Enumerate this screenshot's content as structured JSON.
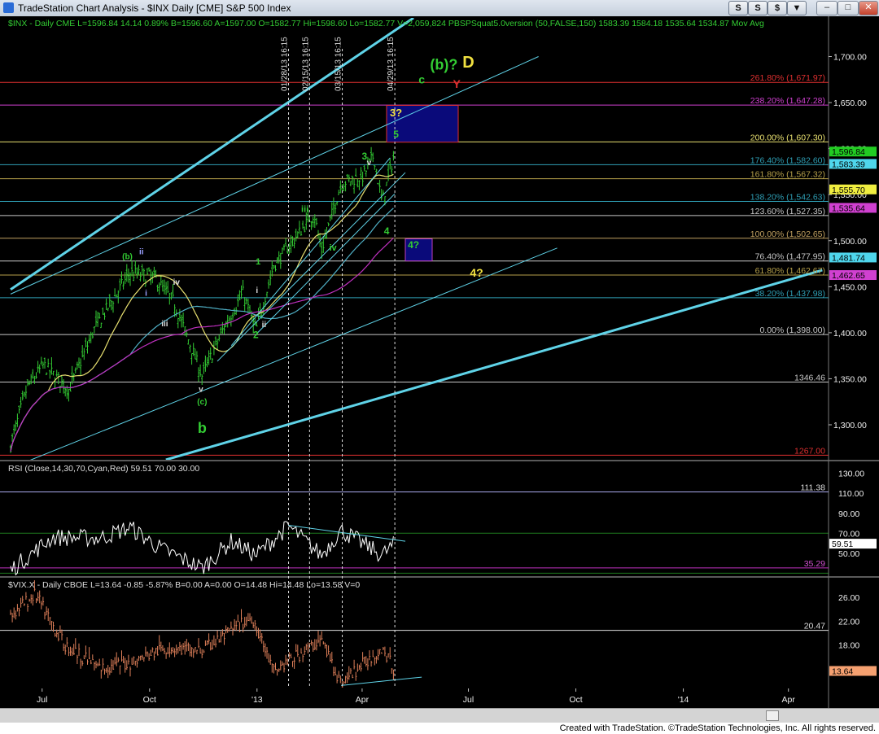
{
  "window": {
    "title": "TradeStation Chart Analysis - $INX Daily [CME] S&P 500 Index",
    "toolbar_buttons": [
      "S",
      "S",
      "$",
      "▼"
    ],
    "window_buttons": [
      "–",
      "□",
      "✕"
    ]
  },
  "footer": {
    "text": "Created with TradeStation. ©TradeStation Technologies, Inc. All rights reserved."
  },
  "colors": {
    "background": "#000000",
    "price_bar": "#33cc33",
    "vix_bar": "#e0805a",
    "rsi_line": "#ffffff",
    "channel": "#5fd3e8",
    "ma_yellow": "#e8e070",
    "ma_cyan": "#4fb0c6",
    "ma_magenta": "#c030c0"
  },
  "chart_data": [
    {
      "type": "candlestick",
      "header": "$INX - Daily CME L=1596.84 14.14 0.89% B=1596.60 A=1597.00 O=1582.77 Hi=1598.60 Lo=1582.77 V=2,059,824 PBSPSquat5.0version (50,FALSE,150) 1583.39 1584.18 1535.64 1534.87 Mov Avg",
      "x_ticks": [
        "Jul",
        "Oct",
        "'13",
        "Apr",
        "Jul",
        "Oct",
        "'14",
        "Apr"
      ],
      "y_ticks": [
        "1,700.00",
        "1,650.00",
        "1,600.00",
        "1,550.00",
        "1,500.00",
        "1,450.00",
        "1,400.00",
        "1,350.00",
        "1,300.00"
      ],
      "ylim": [
        1262,
        1742
      ],
      "grid": false,
      "series_close": [
        {
          "date": "2012-06-04",
          "value": 1278
        },
        {
          "date": "2012-06-18",
          "value": 1340
        },
        {
          "date": "2012-07-02",
          "value": 1365
        },
        {
          "date": "2012-07-24",
          "value": 1338
        },
        {
          "date": "2012-08-15",
          "value": 1405
        },
        {
          "date": "2012-09-14",
          "value": 1465
        },
        {
          "date": "2012-10-05",
          "value": 1460
        },
        {
          "date": "2012-10-22",
          "value": 1433
        },
        {
          "date": "2012-11-15",
          "value": 1353
        },
        {
          "date": "2012-12-05",
          "value": 1409
        },
        {
          "date": "2012-12-20",
          "value": 1443
        },
        {
          "date": "2012-12-31",
          "value": 1402
        },
        {
          "date": "2013-01-15",
          "value": 1472
        },
        {
          "date": "2013-02-19",
          "value": 1530
        },
        {
          "date": "2013-02-25",
          "value": 1488
        },
        {
          "date": "2013-03-14",
          "value": 1563
        },
        {
          "date": "2013-04-02",
          "value": 1570
        },
        {
          "date": "2013-04-11",
          "value": 1593
        },
        {
          "date": "2013-04-18",
          "value": 1541
        },
        {
          "date": "2013-04-29",
          "value": 1597
        }
      ],
      "levels": [
        {
          "label": "261.80% (1,671.97)",
          "value": 1671.97,
          "color": "#e03030"
        },
        {
          "label": "238.20% (1,647.28)",
          "value": 1647.28,
          "color": "#d040d0"
        },
        {
          "label": "200.00% (1,607.30)",
          "value": 1607.3,
          "color": "#e8e070"
        },
        {
          "label": "176.40% (1,582.60)",
          "value": 1582.6,
          "color": "#2f9fb5"
        },
        {
          "label": "161.80% (1,567.32)",
          "value": 1567.32,
          "color": "#b6a04a"
        },
        {
          "label": "138.20% (1,542.63)",
          "value": 1542.63,
          "color": "#2f9fb5"
        },
        {
          "label": "123.60% (1,527.35)",
          "value": 1527.35,
          "color": "#c7c7c7"
        },
        {
          "label": "100.00% (1,502.65)",
          "value": 1502.65,
          "color": "#c0a060"
        },
        {
          "label": "76.40% (1,477.95)",
          "value": 1477.95,
          "color": "#c7c7c7"
        },
        {
          "label": "61.80% (1,462.67)",
          "value": 1462.67,
          "color": "#b6a04a"
        },
        {
          "label": "38.20% (1,437.98)",
          "value": 1437.98,
          "color": "#2f9fb5"
        },
        {
          "label": "0.00% (1,398.00)",
          "value": 1398.0,
          "color": "#c7c7c7"
        },
        {
          "label": "1346.46",
          "value": 1346.46,
          "color": "#c7c7c7"
        },
        {
          "label": "1267.00",
          "value": 1267.0,
          "color": "#e03030"
        }
      ],
      "right_labels": [
        {
          "label": "1,596.84",
          "value": 1596.84,
          "bg": "#22cc22"
        },
        {
          "label": "1,583.39",
          "value": 1583.39,
          "bg": "#4fd6ec"
        },
        {
          "label": "1,555.70",
          "value": 1555.7,
          "bg": "#f0ee40"
        },
        {
          "label": "1,535.64",
          "value": 1535.64,
          "bg": "#d040d0"
        },
        {
          "label": "1,481.74",
          "value": 1481.74,
          "bg": "#4fd6ec"
        },
        {
          "label": "1,462.65",
          "value": 1462.65,
          "bg": "#d040d0"
        }
      ],
      "vertical_markers": [
        "01/28/13 16:15",
        "02/15/13 16:15",
        "03/15/13 16:15",
        "04/29/13 16:15"
      ],
      "annotations": [
        {
          "text": "(b)",
          "color": "#33cc33"
        },
        {
          "text": "ii",
          "color": "#9aa0ff"
        },
        {
          "text": "iv",
          "color": "#dddddd"
        },
        {
          "text": "i",
          "color": "#9aa0ff"
        },
        {
          "text": "iii",
          "color": "#dddddd"
        },
        {
          "text": "v",
          "color": "#dddddd"
        },
        {
          "text": "(c)",
          "color": "#33cc33"
        },
        {
          "text": "b",
          "color": "#33cc33"
        },
        {
          "text": "1",
          "color": "#33cc33"
        },
        {
          "text": "i",
          "color": "#dddddd"
        },
        {
          "text": "ii",
          "color": "#dddddd"
        },
        {
          "text": "2",
          "color": "#33cc33"
        },
        {
          "text": "iii",
          "color": "#33cc33"
        },
        {
          "text": "iv",
          "color": "#33cc33"
        },
        {
          "text": "3",
          "color": "#33cc33"
        },
        {
          "text": "v",
          "color": "#dddddd"
        },
        {
          "text": "4",
          "color": "#33cc33"
        },
        {
          "text": "5",
          "color": "#33cc33"
        },
        {
          "text": "3?",
          "color": "#f0e040"
        },
        {
          "text": "4?",
          "color": "#33cc33"
        },
        {
          "text": "4?",
          "color": "#f0e040"
        },
        {
          "text": "c",
          "color": "#33cc33"
        },
        {
          "text": "(b)?",
          "color": "#33cc33"
        },
        {
          "text": "D",
          "color": "#f0e040"
        },
        {
          "text": "Y",
          "color": "#e03030"
        }
      ]
    },
    {
      "type": "line",
      "header": "RSI (Close,14,30,70,Cyan,Red) 59.51 70.00 30.00",
      "y_ticks": [
        "130.00",
        "110.00",
        "90.00",
        "70.00",
        "50.00"
      ],
      "ylim": [
        27,
        142
      ],
      "levels": [
        {
          "label": "111.38",
          "value": 111.38
        },
        {
          "label": "35.29",
          "value": 35.29
        }
      ],
      "right_labels": [
        {
          "label": "59.51",
          "value": 59.51,
          "bg": "#ffffff"
        }
      ],
      "series_name": "RSI",
      "series_values": [
        {
          "date": "2012-06-04",
          "value": 33
        },
        {
          "date": "2012-07-10",
          "value": 66
        },
        {
          "date": "2012-08-20",
          "value": 65
        },
        {
          "date": "2012-09-14",
          "value": 76
        },
        {
          "date": "2012-10-10",
          "value": 55
        },
        {
          "date": "2012-11-15",
          "value": 35
        },
        {
          "date": "2012-12-10",
          "value": 62
        },
        {
          "date": "2012-12-31",
          "value": 48
        },
        {
          "date": "2013-01-28",
          "value": 77
        },
        {
          "date": "2013-02-25",
          "value": 48
        },
        {
          "date": "2013-03-14",
          "value": 73
        },
        {
          "date": "2013-04-18",
          "value": 48
        },
        {
          "date": "2013-04-29",
          "value": 59.51
        }
      ]
    },
    {
      "type": "candlestick",
      "header": "$VIX.X - Daily CBOE L=13.64 -0.85 -5.87% B=0.00 A=0.00 O=14.48 Hi=14.48 Lo=13.58 V=0",
      "y_ticks": [
        "26.00",
        "22.00",
        "18.00",
        "14.00"
      ],
      "ylim": [
        10.7,
        29.3
      ],
      "levels": [
        {
          "label": "20.47",
          "value": 20.47
        }
      ],
      "right_labels": [
        {
          "label": "13.64",
          "value": 13.64,
          "bg": "#f5a070"
        }
      ],
      "series_close": [
        {
          "date": "2012-06-04",
          "value": 23
        },
        {
          "date": "2012-06-25",
          "value": 26.5
        },
        {
          "date": "2012-07-20",
          "value": 18
        },
        {
          "date": "2012-08-20",
          "value": 14
        },
        {
          "date": "2012-09-14",
          "value": 15
        },
        {
          "date": "2012-10-15",
          "value": 17.5
        },
        {
          "date": "2012-11-15",
          "value": 17
        },
        {
          "date": "2012-12-28",
          "value": 22.7
        },
        {
          "date": "2013-01-15",
          "value": 13.5
        },
        {
          "date": "2013-02-25",
          "value": 18.9
        },
        {
          "date": "2013-03-14",
          "value": 11.5
        },
        {
          "date": "2013-04-18",
          "value": 17.6
        },
        {
          "date": "2013-04-29",
          "value": 13.64
        }
      ]
    }
  ]
}
